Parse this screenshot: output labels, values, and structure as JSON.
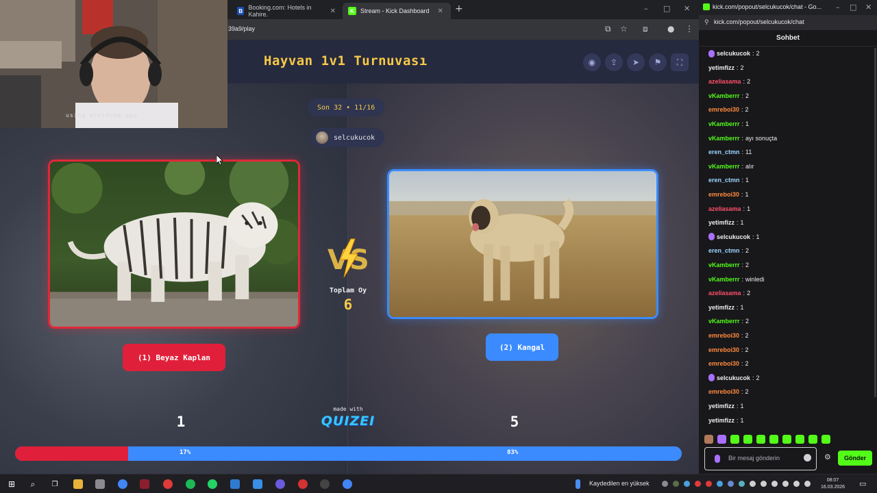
{
  "browser": {
    "tabs": [
      {
        "label": "Booking.com: Hotels in Kahire.",
        "favicon": "B",
        "color": "#1a4fb5"
      },
      {
        "label": "Stream - Kick Dashboard",
        "favicon": "K",
        "color": "#53fc18"
      }
    ],
    "url": "39a9/play"
  },
  "quiz": {
    "title": "Hayvan 1v1 Turnuvası",
    "round": "Son 32 • 11/16",
    "host": "selcukucok",
    "total_label": "Toplam Oy",
    "total_votes": "6",
    "left": {
      "label": "(1) Beyaz Kaplan",
      "votes": "1",
      "percent": "17%",
      "fraction": 0.17,
      "color": "#e0203a"
    },
    "right": {
      "label": "(2) Kangal",
      "votes": "5",
      "percent": "83%",
      "fraction": 0.83,
      "color": "#3b8bff"
    },
    "made_with": "made with",
    "brand": "QUIZEI"
  },
  "webcam": {
    "watermark": "using droidcam.app"
  },
  "chat": {
    "window_title": "kick.com/popout/selcukucok/chat - Go...",
    "url": "kick.com/popout/selcukucok/chat",
    "header": "Sohbet",
    "messages": [
      {
        "user": "selcukucok",
        "text": "2",
        "color": "#efeff1",
        "badge": true
      },
      {
        "user": "yetimfizz",
        "text": "2",
        "color": "#efeff1",
        "badge": false
      },
      {
        "user": "azeliasama",
        "text": "2",
        "color": "#ff4f6a",
        "badge": false
      },
      {
        "user": "vKamberrr",
        "text": "2",
        "color": "#53fc18",
        "badge": false
      },
      {
        "user": "emreboi30",
        "text": "2",
        "color": "#ff8a3d",
        "badge": false
      },
      {
        "user": "vKamberrr",
        "text": "1",
        "color": "#53fc18",
        "badge": false
      },
      {
        "user": "vKamberrr",
        "text": "ayı sonuçta",
        "color": "#53fc18",
        "badge": false
      },
      {
        "user": "eren_ctmn",
        "text": "11",
        "color": "#9ad7ff",
        "badge": false
      },
      {
        "user": "vKamberrr",
        "text": "alır",
        "color": "#53fc18",
        "badge": false
      },
      {
        "user": "eren_ctmn",
        "text": "1",
        "color": "#9ad7ff",
        "badge": false
      },
      {
        "user": "emreboi30",
        "text": "1",
        "color": "#ff8a3d",
        "badge": false
      },
      {
        "user": "azeliasama",
        "text": "1",
        "color": "#ff4f6a",
        "badge": false
      },
      {
        "user": "yetimfizz",
        "text": "1",
        "color": "#efeff1",
        "badge": false
      },
      {
        "user": "selcukucok",
        "text": "1",
        "color": "#efeff1",
        "badge": true
      },
      {
        "user": "eren_ctmn",
        "text": "2",
        "color": "#9ad7ff",
        "badge": false
      },
      {
        "user": "vKamberrr",
        "text": "2",
        "color": "#53fc18",
        "badge": false
      },
      {
        "user": "vKamberrr",
        "text": "winledi",
        "color": "#53fc18",
        "badge": false
      },
      {
        "user": "azeliasama",
        "text": "2",
        "color": "#ff4f6a",
        "badge": false
      },
      {
        "user": "yetimfizz",
        "text": "1",
        "color": "#efeff1",
        "badge": false
      },
      {
        "user": "vKamberrr",
        "text": "2",
        "color": "#53fc18",
        "badge": false
      },
      {
        "user": "emreboi30",
        "text": "2",
        "color": "#ff8a3d",
        "badge": false
      },
      {
        "user": "emreboi30",
        "text": "2",
        "color": "#ff8a3d",
        "badge": false
      },
      {
        "user": "emreboi30",
        "text": "2",
        "color": "#ff8a3d",
        "badge": false
      },
      {
        "user": "selcukucok",
        "text": "2",
        "color": "#efeff1",
        "badge": true
      },
      {
        "user": "emreboi30",
        "text": "2",
        "color": "#ff8a3d",
        "badge": false
      },
      {
        "user": "yetimfizz",
        "text": "1",
        "color": "#efeff1",
        "badge": false
      },
      {
        "user": "yetimfizz",
        "text": "1",
        "color": "#efeff1",
        "badge": false
      }
    ],
    "input_placeholder": "Bir mesaj gönderin",
    "send_label": "Gönder"
  },
  "taskbar": {
    "note": "Kaydedilen en yüksek",
    "time": "08:07",
    "date": "16.03.2026"
  }
}
